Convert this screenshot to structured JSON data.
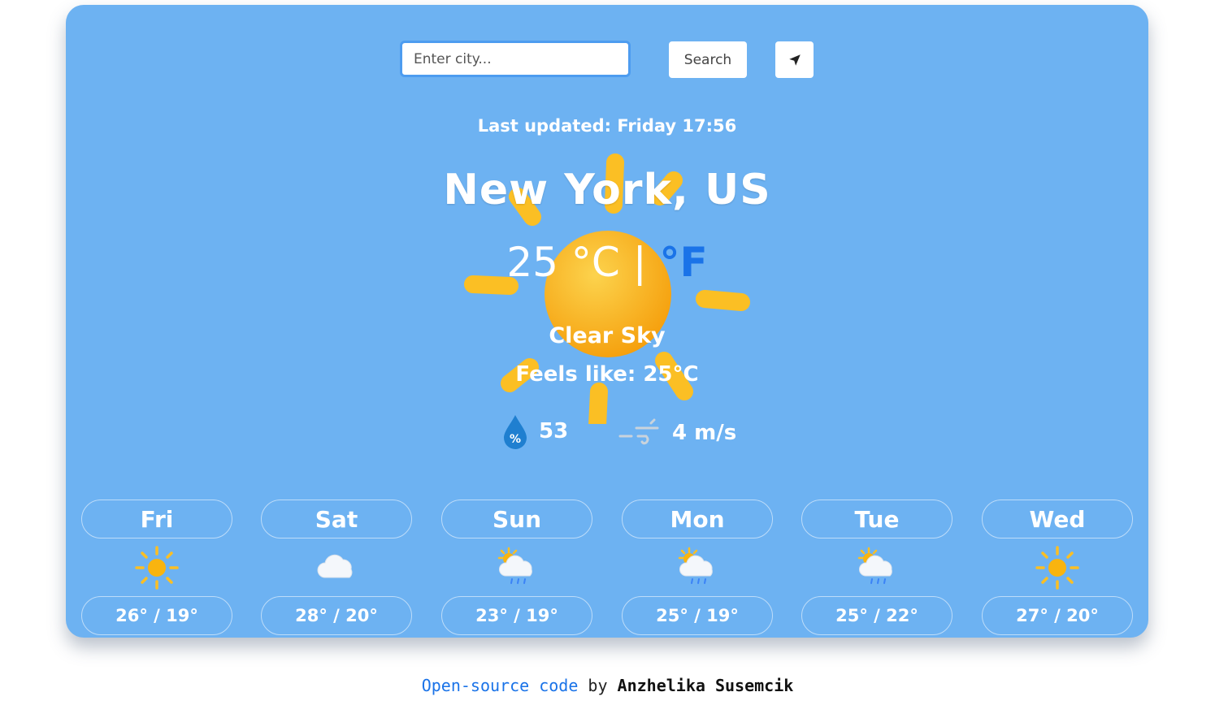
{
  "search": {
    "placeholder": "Enter city...",
    "button_label": "Search"
  },
  "icons": {
    "location": "location-arrow-icon",
    "humidity": "humidity-drop-icon",
    "wind": "wind-icon"
  },
  "current": {
    "last_updated": "Last updated: Friday 17:56",
    "city": "New York, US",
    "temp": "25",
    "unit_c": "°C",
    "unit_sep": "|",
    "unit_f": "°F",
    "description": "Clear Sky",
    "feels_like": "Feels like: 25°C",
    "humidity": "53",
    "wind": "4 m/s",
    "icon": "sun-icon"
  },
  "forecast": [
    {
      "day": "Fri",
      "icon": "sun-icon",
      "range": "26° / 19°"
    },
    {
      "day": "Sat",
      "icon": "cloud-icon",
      "range": "28° / 20°"
    },
    {
      "day": "Sun",
      "icon": "sun-cloud-rain-icon",
      "range": "23° / 19°"
    },
    {
      "day": "Mon",
      "icon": "sun-cloud-rain-icon",
      "range": "25° / 19°"
    },
    {
      "day": "Tue",
      "icon": "sun-cloud-rain-icon",
      "range": "25° / 22°"
    },
    {
      "day": "Wed",
      "icon": "sun-icon",
      "range": "27° / 20°"
    }
  ],
  "footer": {
    "link_text": "Open-source code",
    "by_text": "by",
    "author": "Anzhelika Susemcik"
  },
  "colors": {
    "card_bg": "#6db2f2",
    "accent": "#1a73e8",
    "sun": "#fbbf24"
  }
}
